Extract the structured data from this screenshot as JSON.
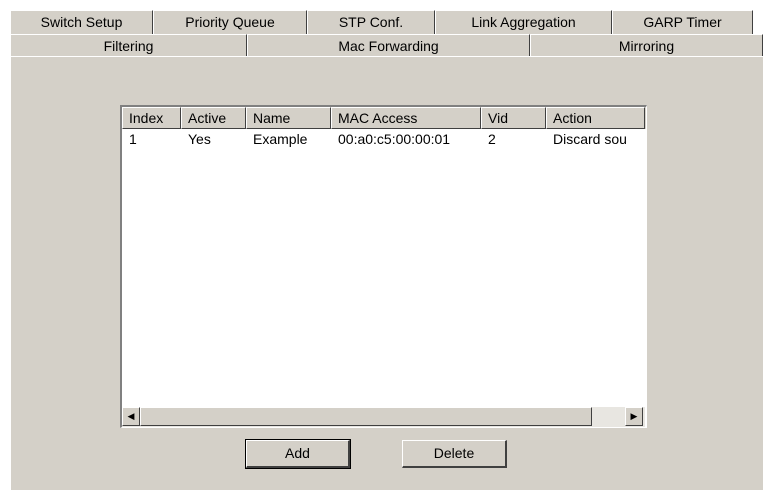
{
  "tabs_row1": [
    "Switch Setup",
    "Priority Queue",
    "STP Conf.",
    "Link Aggregation",
    "GARP Timer"
  ],
  "tabs_row2": [
    "Filtering",
    "Mac Forwarding",
    "Mirroring"
  ],
  "table": {
    "columns": [
      "Index",
      "Active",
      "Name",
      "MAC Access",
      "Vid",
      "Action"
    ],
    "rows": [
      [
        "1",
        "Yes",
        "Example",
        "00:a0:c5:00:00:01",
        "2",
        "Discard sou"
      ]
    ]
  },
  "scroll": {
    "left_icon": "scroll-left-arrow-icon",
    "right_icon": "scroll-right-arrow-icon",
    "left_glyph": "◀",
    "right_glyph": "▶"
  },
  "buttons": {
    "add": "Add",
    "delete": "Delete"
  },
  "colors": {
    "panel_bg": "#d4d0c8",
    "table_bg": "#ffffff"
  }
}
